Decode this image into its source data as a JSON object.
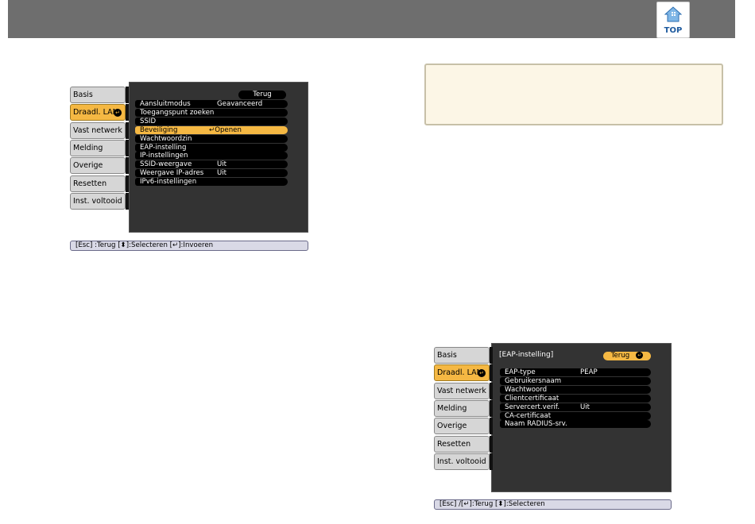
{
  "top_icon": {
    "label": "TOP"
  },
  "screen1": {
    "tabs": [
      "Basis",
      "Draadl. LAN",
      "Vast netwerk",
      "Melding",
      "Overige",
      "Resetten",
      "Inst. voltooid"
    ],
    "active_tab_index": 1,
    "back_button": "Terug",
    "rows": [
      {
        "label": "Aansluitmodus",
        "value": "Geavanceerd"
      },
      {
        "label": "Toegangspunt zoeken",
        "value": ""
      },
      {
        "label": "SSID",
        "value": ""
      },
      {
        "label": "Beveiliging",
        "value": "Openen"
      },
      {
        "label": "Wachtwoordzin",
        "value": ""
      },
      {
        "label": "EAP-instelling",
        "value": ""
      },
      {
        "label": "IP-instellingen",
        "value": ""
      },
      {
        "label": "SSID-weergave",
        "value": "Uit"
      },
      {
        "label": "Weergave IP-adres",
        "value": "Uit"
      },
      {
        "label": "IPv6-instellingen",
        "value": ""
      }
    ],
    "selected_row_index": 3,
    "status": "[Esc] :Terug  [⬍]:Selecteren  [↵]:Invoeren"
  },
  "screen2": {
    "tabs": [
      "Basis",
      "Draadl. LAN",
      "Vast netwerk",
      "Melding",
      "Overige",
      "Resetten",
      "Inst. voltooid"
    ],
    "active_tab_index": 1,
    "title": "[EAP-instelling]",
    "back_button": "Terug",
    "rows": [
      {
        "label": "EAP-type",
        "value": "PEAP"
      },
      {
        "label": "Gebruikersnaam",
        "value": ""
      },
      {
        "label": "Wachtwoord",
        "value": ""
      },
      {
        "label": "Clientcertificaat",
        "value": ""
      },
      {
        "label": "Servercert.verif.",
        "value": "Uit"
      },
      {
        "label": "CA-certificaat",
        "value": ""
      },
      {
        "label": "Naam RADIUS-srv.",
        "value": ""
      }
    ],
    "status": "[Esc] /[↵]:Terug  [⬍]:Selecteren"
  },
  "colors": {
    "header": "#6e6e6e",
    "accent": "#f5b843",
    "panel": "#333333",
    "note_bg": "#fcf6e6"
  }
}
